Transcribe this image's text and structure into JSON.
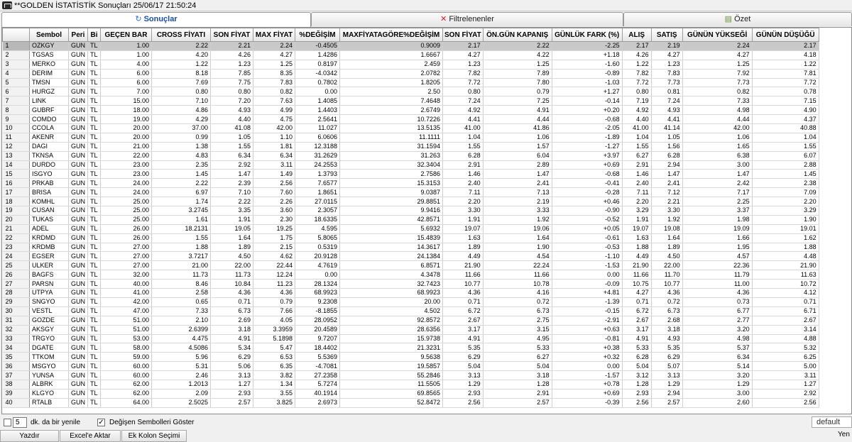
{
  "window": {
    "title": "**GOLDEN İSTATİSTİK Sonuçları  25/06/17 21:50:24"
  },
  "tabs": [
    {
      "label": "Sonuçlar",
      "icon": "refresh-icon",
      "active": true
    },
    {
      "label": "Filtrelenenler",
      "icon": "x-icon",
      "active": false
    },
    {
      "label": "Özet",
      "icon": "summary-icon",
      "active": false
    }
  ],
  "grid": {
    "columns": [
      "Sembol",
      "Peri",
      "Bi",
      "GEÇEN BAR",
      "CROSS FİYATI",
      "SON FİYAT",
      "MAX FİYAT",
      "%DEĞİŞİM",
      "MAXFİYATAGÖRE%DEĞİŞİM",
      "SON FİYAT",
      "ÖN.GÜN KAPANIŞ",
      "GÜNLÜK FARK (%)",
      "ALIŞ",
      "SATIŞ",
      "GÜNÜN YÜKSEĞİ",
      "GÜNÜN DÜŞÜĞÜ"
    ],
    "selected_row": 0,
    "rows": [
      [
        "1",
        "OZKGY",
        "GUN",
        "TL",
        "1.00",
        "2.22",
        "2.21",
        "2.24",
        "-0.4505",
        "0.9009",
        "2.17",
        "2.22",
        "-2.25",
        "2.17",
        "2.19",
        "2.24",
        "2.17"
      ],
      [
        "2",
        "TGSAS",
        "GUN",
        "TL",
        "1.00",
        "4.20",
        "4.26",
        "4.27",
        "1.4286",
        "1.6667",
        "4.27",
        "4.22",
        "+1.18",
        "4.26",
        "4.27",
        "4.27",
        "4.18"
      ],
      [
        "3",
        "MERKO",
        "GUN",
        "TL",
        "4.00",
        "1.22",
        "1.23",
        "1.25",
        "0.8197",
        "2.459",
        "1.23",
        "1.25",
        "-1.60",
        "1.22",
        "1.23",
        "1.25",
        "1.22"
      ],
      [
        "4",
        "DERIM",
        "GUN",
        "TL",
        "6.00",
        "8.18",
        "7.85",
        "8.35",
        "-4.0342",
        "2.0782",
        "7.82",
        "7.89",
        "-0.89",
        "7.82",
        "7.83",
        "7.92",
        "7.81"
      ],
      [
        "5",
        "TMSN",
        "GUN",
        "TL",
        "6.00",
        "7.69",
        "7.75",
        "7.83",
        "0.7802",
        "1.8205",
        "7.72",
        "7.80",
        "-1.03",
        "7.72",
        "7.73",
        "7.73",
        "7.72"
      ],
      [
        "6",
        "HURGZ",
        "GUN",
        "TL",
        "7.00",
        "0.80",
        "0.80",
        "0.82",
        "0.00",
        "2.50",
        "0.80",
        "0.79",
        "+1.27",
        "0.80",
        "0.81",
        "0.82",
        "0.78"
      ],
      [
        "7",
        "LINK",
        "GUN",
        "TL",
        "15.00",
        "7.10",
        "7.20",
        "7.63",
        "1.4085",
        "7.4648",
        "7.24",
        "7.25",
        "-0.14",
        "7.19",
        "7.24",
        "7.33",
        "7.15"
      ],
      [
        "8",
        "GUBRF",
        "GUN",
        "TL",
        "18.00",
        "4.86",
        "4.93",
        "4.99",
        "1.4403",
        "2.6749",
        "4.92",
        "4.91",
        "+0.20",
        "4.92",
        "4.93",
        "4.98",
        "4.90"
      ],
      [
        "9",
        "COMDO",
        "GUN",
        "TL",
        "19.00",
        "4.29",
        "4.40",
        "4.75",
        "2.5641",
        "10.7226",
        "4.41",
        "4.44",
        "-0.68",
        "4.40",
        "4.41",
        "4.44",
        "4.37"
      ],
      [
        "10",
        "CCOLA",
        "GUN",
        "TL",
        "20.00",
        "37.00",
        "41.08",
        "42.00",
        "11.027",
        "13.5135",
        "41.00",
        "41.86",
        "-2.05",
        "41.00",
        "41.14",
        "42.00",
        "40.88"
      ],
      [
        "11",
        "AKENR",
        "GUN",
        "TL",
        "20.00",
        "0.99",
        "1.05",
        "1.10",
        "6.0606",
        "11.1111",
        "1.04",
        "1.06",
        "-1.89",
        "1.04",
        "1.05",
        "1.06",
        "1.04"
      ],
      [
        "12",
        "DAGI",
        "GUN",
        "TL",
        "21.00",
        "1.38",
        "1.55",
        "1.81",
        "12.3188",
        "31.1594",
        "1.55",
        "1.57",
        "-1.27",
        "1.55",
        "1.56",
        "1.65",
        "1.55"
      ],
      [
        "13",
        "TKNSA",
        "GUN",
        "TL",
        "22.00",
        "4.83",
        "6.34",
        "6.34",
        "31.2629",
        "31.263",
        "6.28",
        "6.04",
        "+3.97",
        "6.27",
        "6.28",
        "6.38",
        "6.07"
      ],
      [
        "14",
        "DURDO",
        "GUN",
        "TL",
        "23.00",
        "2.35",
        "2.92",
        "3.11",
        "24.2553",
        "32.3404",
        "2.91",
        "2.89",
        "+0.69",
        "2.91",
        "2.94",
        "3.00",
        "2.88"
      ],
      [
        "15",
        "ISGYO",
        "GUN",
        "TL",
        "23.00",
        "1.45",
        "1.47",
        "1.49",
        "1.3793",
        "2.7586",
        "1.46",
        "1.47",
        "-0.68",
        "1.46",
        "1.47",
        "1.47",
        "1.45"
      ],
      [
        "16",
        "PRKAB",
        "GUN",
        "TL",
        "24.00",
        "2.22",
        "2.39",
        "2.56",
        "7.6577",
        "15.3153",
        "2.40",
        "2.41",
        "-0.41",
        "2.40",
        "2.41",
        "2.42",
        "2.38"
      ],
      [
        "17",
        "BRISA",
        "GUN",
        "TL",
        "24.00",
        "6.97",
        "7.10",
        "7.60",
        "1.8651",
        "9.0387",
        "7.11",
        "7.13",
        "-0.28",
        "7.11",
        "7.12",
        "7.17",
        "7.09"
      ],
      [
        "18",
        "KOMHL",
        "GUN",
        "TL",
        "25.00",
        "1.74",
        "2.22",
        "2.26",
        "27.0115",
        "29.8851",
        "2.20",
        "2.19",
        "+0.46",
        "2.20",
        "2.21",
        "2.25",
        "2.20"
      ],
      [
        "19",
        "CUSAN",
        "GUN",
        "TL",
        "25.00",
        "3.2745",
        "3.35",
        "3.60",
        "2.3057",
        "9.9416",
        "3.30",
        "3.33",
        "-0.90",
        "3.29",
        "3.30",
        "3.37",
        "3.29"
      ],
      [
        "20",
        "TUKAS",
        "GUN",
        "TL",
        "25.00",
        "1.61",
        "1.91",
        "2.30",
        "18.6335",
        "42.8571",
        "1.91",
        "1.92",
        "-0.52",
        "1.91",
        "1.92",
        "1.98",
        "1.90"
      ],
      [
        "21",
        "ADEL",
        "GUN",
        "TL",
        "26.00",
        "18.2131",
        "19.05",
        "19.25",
        "4.595",
        "5.6932",
        "19.07",
        "19.06",
        "+0.05",
        "19.07",
        "19.08",
        "19.09",
        "19.01"
      ],
      [
        "22",
        "KRDMD",
        "GUN",
        "TL",
        "26.00",
        "1.55",
        "1.64",
        "1.75",
        "5.8065",
        "15.4839",
        "1.63",
        "1.64",
        "-0.61",
        "1.63",
        "1.64",
        "1.66",
        "1.62"
      ],
      [
        "23",
        "KRDMB",
        "GUN",
        "TL",
        "27.00",
        "1.88",
        "1.89",
        "2.15",
        "0.5319",
        "14.3617",
        "1.89",
        "1.90",
        "-0.53",
        "1.88",
        "1.89",
        "1.95",
        "1.88"
      ],
      [
        "24",
        "EGSER",
        "GUN",
        "TL",
        "27.00",
        "3.7217",
        "4.50",
        "4.62",
        "20.9128",
        "24.1384",
        "4.49",
        "4.54",
        "-1.10",
        "4.49",
        "4.50",
        "4.57",
        "4.48"
      ],
      [
        "25",
        "ULKER",
        "GUN",
        "TL",
        "27.00",
        "21.00",
        "22.00",
        "22.44",
        "4.7619",
        "6.8571",
        "21.90",
        "22.24",
        "-1.53",
        "21.90",
        "22.00",
        "22.36",
        "21.90"
      ],
      [
        "26",
        "BAGFS",
        "GUN",
        "TL",
        "32.00",
        "11.73",
        "11.73",
        "12.24",
        "0.00",
        "4.3478",
        "11.66",
        "11.66",
        "0.00",
        "11.66",
        "11.70",
        "11.79",
        "11.63"
      ],
      [
        "27",
        "PARSN",
        "GUN",
        "TL",
        "40.00",
        "8.46",
        "10.84",
        "11.23",
        "28.1324",
        "32.7423",
        "10.77",
        "10.78",
        "-0.09",
        "10.75",
        "10.77",
        "11.00",
        "10.72"
      ],
      [
        "28",
        "UTPYA",
        "GUN",
        "TL",
        "41.00",
        "2.58",
        "4.36",
        "4.36",
        "68.9923",
        "68.9923",
        "4.36",
        "4.16",
        "+4.81",
        "4.27",
        "4.36",
        "4.36",
        "4.12"
      ],
      [
        "29",
        "SNGYO",
        "GUN",
        "TL",
        "42.00",
        "0.65",
        "0.71",
        "0.79",
        "9.2308",
        "20.00",
        "0.71",
        "0.72",
        "-1.39",
        "0.71",
        "0.72",
        "0.73",
        "0.71"
      ],
      [
        "30",
        "VESTL",
        "GUN",
        "TL",
        "47.00",
        "7.33",
        "6.73",
        "7.66",
        "-8.1855",
        "4.502",
        "6.72",
        "6.73",
        "-0.15",
        "6.72",
        "6.73",
        "6.77",
        "6.71"
      ],
      [
        "31",
        "GOZDE",
        "GUN",
        "TL",
        "51.00",
        "2.10",
        "2.69",
        "4.05",
        "28.0952",
        "92.8572",
        "2.67",
        "2.75",
        "-2.91",
        "2.67",
        "2.68",
        "2.77",
        "2.67"
      ],
      [
        "32",
        "AKSGY",
        "GUN",
        "TL",
        "51.00",
        "2.6399",
        "3.18",
        "3.3959",
        "20.4589",
        "28.6356",
        "3.17",
        "3.15",
        "+0.63",
        "3.17",
        "3.18",
        "3.20",
        "3.14"
      ],
      [
        "33",
        "TRGYO",
        "GUN",
        "TL",
        "53.00",
        "4.475",
        "4.91",
        "5.1898",
        "9.7207",
        "15.9738",
        "4.91",
        "4.95",
        "-0.81",
        "4.91",
        "4.93",
        "4.98",
        "4.88"
      ],
      [
        "34",
        "DGATE",
        "GUN",
        "TL",
        "58.00",
        "4.5086",
        "5.34",
        "5.47",
        "18.4402",
        "21.3231",
        "5.35",
        "5.33",
        "+0.38",
        "5.33",
        "5.35",
        "5.37",
        "5.32"
      ],
      [
        "35",
        "TTKOM",
        "GUN",
        "TL",
        "59.00",
        "5.96",
        "6.29",
        "6.53",
        "5.5369",
        "9.5638",
        "6.29",
        "6.27",
        "+0.32",
        "6.28",
        "6.29",
        "6.34",
        "6.25"
      ],
      [
        "36",
        "MSGYO",
        "GUN",
        "TL",
        "60.00",
        "5.31",
        "5.06",
        "6.35",
        "-4.7081",
        "19.5857",
        "5.04",
        "5.04",
        "0.00",
        "5.04",
        "5.07",
        "5.14",
        "5.00"
      ],
      [
        "37",
        "YUNSA",
        "GUN",
        "TL",
        "60.00",
        "2.46",
        "3.13",
        "3.82",
        "27.2358",
        "55.2846",
        "3.13",
        "3.18",
        "-1.57",
        "3.12",
        "3.13",
        "3.20",
        "3.11"
      ],
      [
        "38",
        "ALBRK",
        "GUN",
        "TL",
        "62.00",
        "1.2013",
        "1.27",
        "1.34",
        "5.7274",
        "11.5505",
        "1.29",
        "1.28",
        "+0.78",
        "1.28",
        "1.29",
        "1.29",
        "1.27"
      ],
      [
        "39",
        "KLGYO",
        "GUN",
        "TL",
        "62.00",
        "2.09",
        "2.93",
        "3.55",
        "40.1914",
        "69.8565",
        "2.93",
        "2.91",
        "+0.69",
        "2.93",
        "2.94",
        "3.00",
        "2.92"
      ],
      [
        "40",
        "RTALB",
        "GUN",
        "TL",
        "64.00",
        "2.5025",
        "2.57",
        "3.825",
        "2.6973",
        "52.8472",
        "2.56",
        "2.57",
        "-0.39",
        "2.56",
        "2.57",
        "2.60",
        "2.56"
      ]
    ]
  },
  "bottom": {
    "refresh_value": "5",
    "refresh_label": "dk. da bir yenile",
    "refresh_checked": false,
    "changed_label": "Değişen Sembolleri Göster",
    "changed_checked": true,
    "print_label": "Yazdır",
    "excel_label": "Excel'e Aktar",
    "columns_label": "Ek Kolon Seçimi",
    "default_label": "default",
    "new_label": "Yen"
  }
}
